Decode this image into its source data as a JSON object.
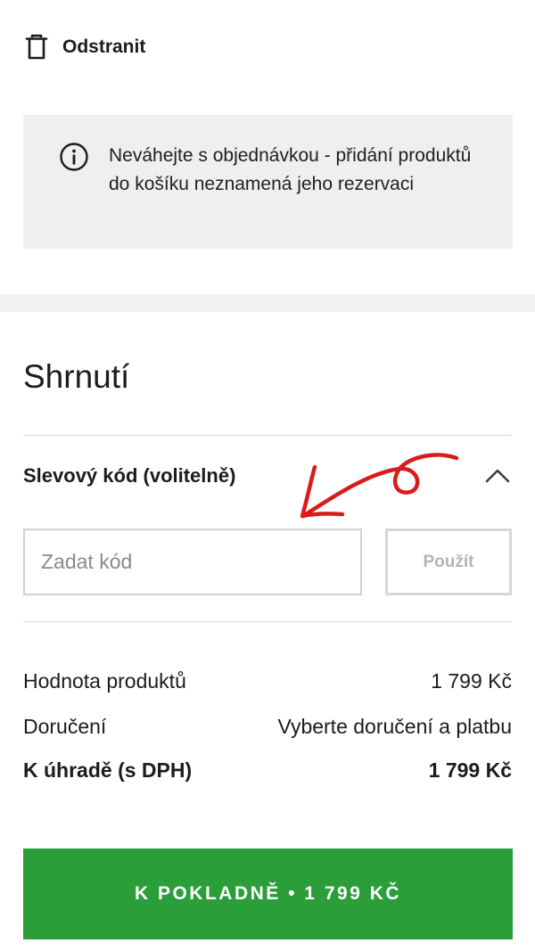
{
  "remove": {
    "label": "Odstranit",
    "icon": "trash-icon"
  },
  "info": {
    "icon": "info-circle-icon",
    "text": "Neváhejte s objednávkou - přidání produktů do košíku neznamená jeho rezervaci"
  },
  "summary": {
    "title": "Shrnutí",
    "discount": {
      "label": "Slevový kód (volitelně)",
      "toggle_icon": "chevron-up-icon",
      "input_placeholder": "Zadat kód",
      "input_value": "",
      "apply_label": "Použít"
    },
    "rows": [
      {
        "label": "Hodnota produktů",
        "value": "1 799 Kč"
      },
      {
        "label": "Doručení",
        "value": "Vyberte doručení a platbu"
      },
      {
        "label": "K úhradě (s DPH)",
        "value": "1 799 Kč"
      }
    ]
  },
  "checkout": {
    "label": "K POKLADNĚ • 1 799 KČ"
  },
  "colors": {
    "accent_green": "#2b9e3a",
    "info_bg": "#efefef",
    "annotation_red": "#d81b1b"
  }
}
